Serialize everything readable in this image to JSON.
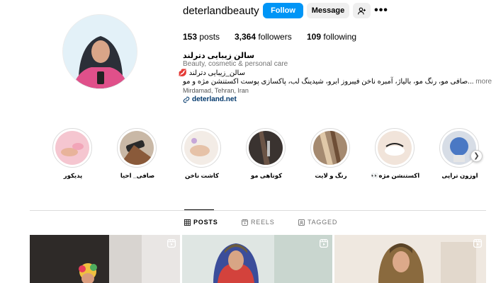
{
  "profile": {
    "username": "deterlandbeauty",
    "follow_label": "Follow",
    "message_label": "Message",
    "more_glyph": "•••",
    "posts_count": "153",
    "posts_label": "posts",
    "followers_count": "3,364",
    "followers_label": "followers",
    "following_count": "109",
    "following_label": "following"
  },
  "bio": {
    "name": "سالن زیبایی دترلند",
    "category": "Beauty, cosmetic & personal care",
    "line1": "سالن_زیبایی دترلند 💋",
    "line2": "...صافی مو، رنگ مو، بالیاژ، آمبره ناخن فیبروز ابرو، شیدینگ لب، پاکسازی پوست اکستنشن مژه و مو",
    "more_label": "more",
    "location": "Mirdamad, Tehran, Iran",
    "link": "deterland.net"
  },
  "highlights": [
    {
      "label": "پدیکور"
    },
    {
      "label": "صافی_ احیا"
    },
    {
      "label": "کاشت ناخن"
    },
    {
      "label": "کوتاهی مو"
    },
    {
      "label": "رنگ و لایت"
    },
    {
      "label": "اکستنشن مژه👀"
    },
    {
      "label": "اوزون تراپی"
    }
  ],
  "tabs": [
    {
      "label": "POSTS",
      "icon": "grid-icon"
    },
    {
      "label": "REELS",
      "icon": "reels-icon"
    },
    {
      "label": "TAGGED",
      "icon": "tagged-icon"
    }
  ],
  "colors": {
    "follow_button": "#0095f6",
    "secondary_button": "#efefef",
    "link": "#00376b",
    "muted_text": "#737373"
  }
}
